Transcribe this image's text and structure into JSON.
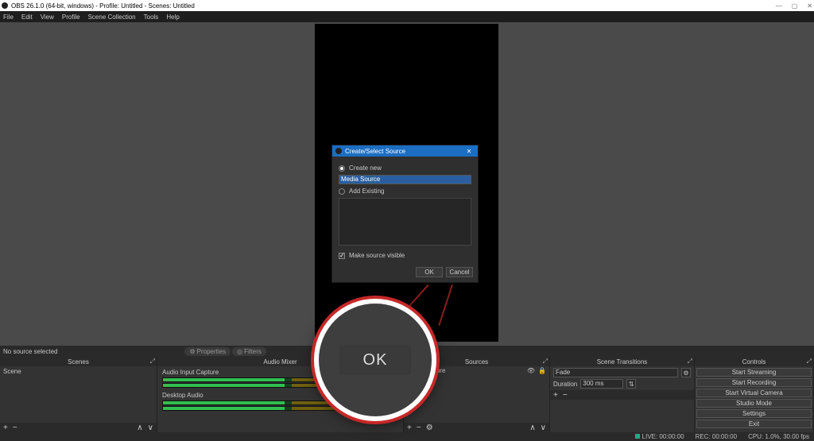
{
  "titlebar": {
    "title": "OBS 26.1.0 (64-bit, windows) - Profile: Untitled - Scenes: Untitled"
  },
  "menu": {
    "items": [
      "File",
      "Edit",
      "View",
      "Profile",
      "Scene Collection",
      "Tools",
      "Help"
    ]
  },
  "selected_row": {
    "label": "No source selected",
    "properties": "Properties",
    "filters": "Filters"
  },
  "panels": {
    "scenes": {
      "title": "Scenes",
      "items": [
        "Scene"
      ]
    },
    "mixer": {
      "title": "Audio Mixer",
      "tracks": [
        "Audio Input Capture",
        "Desktop Audio"
      ]
    },
    "sources": {
      "title": "Sources",
      "items": [
        "Input Capture"
      ]
    },
    "transitions": {
      "title": "Scene Transitions",
      "selected": "Fade",
      "duration_label": "Duration",
      "duration_value": "300 ms"
    },
    "controls": {
      "title": "Controls",
      "buttons": [
        "Start Streaming",
        "Start Recording",
        "Start Virtual Camera",
        "Studio Mode",
        "Settings",
        "Exit"
      ]
    }
  },
  "dialog": {
    "title": "Create/Select Source",
    "create_label": "Create new",
    "input_value": "Media Source",
    "add_existing": "Add Existing",
    "make_visible": "Make source visible",
    "ok": "OK",
    "cancel": "Cancel"
  },
  "magnifier": {
    "ok": "OK"
  },
  "footer_symbols": {
    "plus": "+",
    "minus": "−",
    "up": "∧",
    "down": "∨",
    "gear": "⚙",
    "speaker": "🔊"
  },
  "statusbar": {
    "live": "LIVE: 00:00:00",
    "rec": "REC: 00:00:00",
    "cpu": "CPU: 1.0%, 30.00 fps"
  }
}
